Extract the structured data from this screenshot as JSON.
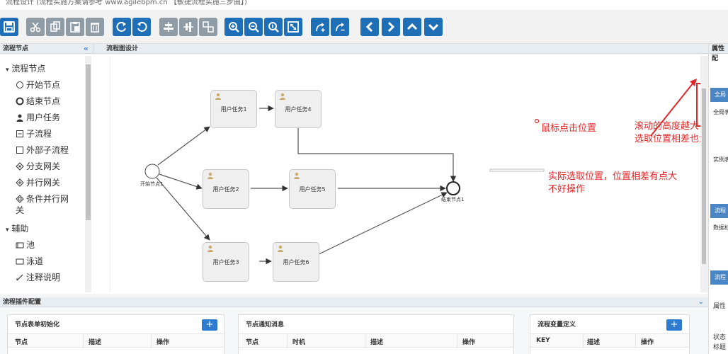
{
  "window": {
    "title": "流程设计 (流程实施方案请参考 www.agilebpm.cn 【敏捷流程实施三步曲】)"
  },
  "toolbar": {
    "buttons": [
      {
        "name": "save",
        "icon": "save-icon"
      },
      {
        "name": "cut",
        "icon": "scissors-icon"
      },
      {
        "name": "copy",
        "icon": "copy-icon"
      },
      {
        "name": "paste",
        "icon": "paste-icon"
      },
      {
        "name": "delete",
        "icon": "trash-icon"
      },
      {
        "name": "redo",
        "icon": "redo-icon"
      },
      {
        "name": "undo",
        "icon": "undo-icon"
      },
      {
        "name": "align-center",
        "icon": "align-center-icon"
      },
      {
        "name": "align-middle",
        "icon": "align-middle-icon"
      },
      {
        "name": "group",
        "icon": "group-icon"
      },
      {
        "name": "zoom-in",
        "icon": "zoom-in-icon"
      },
      {
        "name": "zoom-out",
        "icon": "zoom-out-icon"
      },
      {
        "name": "zoom-reset",
        "icon": "zoom-reset-icon"
      },
      {
        "name": "fit",
        "icon": "fit-icon"
      },
      {
        "name": "link-add",
        "icon": "link-add-icon"
      },
      {
        "name": "link-remove",
        "icon": "link-remove-icon"
      },
      {
        "name": "move-left",
        "icon": "chevron-left-icon"
      },
      {
        "name": "move-right",
        "icon": "chevron-right-icon"
      },
      {
        "name": "move-up",
        "icon": "chevron-up-icon"
      },
      {
        "name": "move-down",
        "icon": "chevron-down-icon"
      }
    ]
  },
  "left_panel": {
    "title": "流程节点",
    "groups": [
      {
        "label": "流程节点",
        "items": [
          "开始节点",
          "结束节点",
          "用户任务",
          "子流程",
          "外部子流程",
          "分支网关",
          "并行网关",
          "条件并行网"
        ]
      },
      {
        "label": "辅助",
        "items": [
          "池",
          "泳道",
          "注释说明"
        ]
      }
    ],
    "wrap_text": "关"
  },
  "canvas": {
    "title": "流程图设计",
    "nodes": [
      {
        "label": "用户任务1"
      },
      {
        "label": "用户任务4"
      },
      {
        "label": "用户任务2"
      },
      {
        "label": "用户任务5"
      },
      {
        "label": "用户任务3"
      },
      {
        "label": "用户任务6"
      }
    ],
    "start_label": "开始节点1",
    "end_label": "结束节点1",
    "annotations": {
      "click": "鼠标点击位置",
      "scroll_line1": "滚动的高度越大",
      "scroll_line2": "选取位置相差也大",
      "actual_line1": "实际选取位置，位置相差有点大",
      "actual_line2": "不好操作"
    }
  },
  "right_panel": {
    "title": "属性配",
    "tabs": [
      "全局",
      "流程",
      "流程"
    ],
    "texts": [
      "全局表",
      "实例表",
      "数据标",
      "属性",
      "状态",
      "标题"
    ]
  },
  "bottom": {
    "title": "流程插件配置",
    "panels": [
      {
        "title": "节点表单初始化",
        "columns": [
          "节点",
          "描述",
          "操作"
        ]
      },
      {
        "title": "节点通知消息",
        "columns": [
          "节点",
          "时机",
          "描述",
          "操作"
        ]
      },
      {
        "title": "流程变量定义",
        "columns": [
          "KEY",
          "描述",
          "操作"
        ]
      }
    ]
  },
  "colors": {
    "toolbar_blue": "#1e6fb8",
    "toolbar_gray": "#8f9ba5",
    "accent_red": "#e0282a",
    "tab_blue": "#4a86c5"
  }
}
